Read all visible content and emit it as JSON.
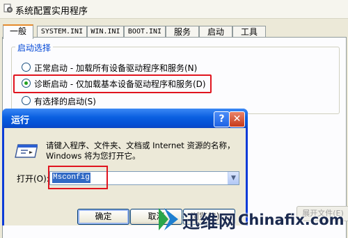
{
  "background_window": {
    "title": "系统配置实用程序",
    "tabs": [
      "一般",
      "SYSTEM.INI",
      "WIN.INI",
      "BOOT.INI",
      "服务",
      "启动",
      "工具"
    ],
    "active_tab": "一般",
    "group_title": "启动选择",
    "options": [
      {
        "label": "正常启动 - 加载所有设备驱动程序和服务(N)",
        "checked": false
      },
      {
        "label": "诊断启动 - 仅加载基本设备驱动程序和服务(D)",
        "checked": true
      },
      {
        "label": "有选择的启动(S)",
        "checked": false
      }
    ],
    "expand_button": "展开文件(E)"
  },
  "run_dialog": {
    "title": "运行",
    "help_label": "?",
    "close_label": "✕",
    "description": "请键入程序、文件夹、文档或 Internet 资源的名称，Windows 将为您打开它。",
    "open_label": "打开(O):",
    "input_value": "Msconfig",
    "buttons": {
      "ok": "确定",
      "cancel": "取消",
      "browse": "浏览(B)..."
    }
  },
  "watermark": {
    "brand_cn": "迅维网",
    "separator": "-",
    "brand_en": "Chinafix.com"
  },
  "colors": {
    "highlight_red": "#e0141e",
    "xp_title_blue": "#0551d5",
    "tab_accent_orange": "#e68b2c",
    "group_title_blue": "#0046d5"
  },
  "icons": {
    "msconfig_title_icon": "gear-config-icon",
    "run_dialog_icon": "run-program-icon",
    "dropdown_icon": "chevron-down-icon",
    "watermark_logo": "chinafix-logo-icon"
  }
}
